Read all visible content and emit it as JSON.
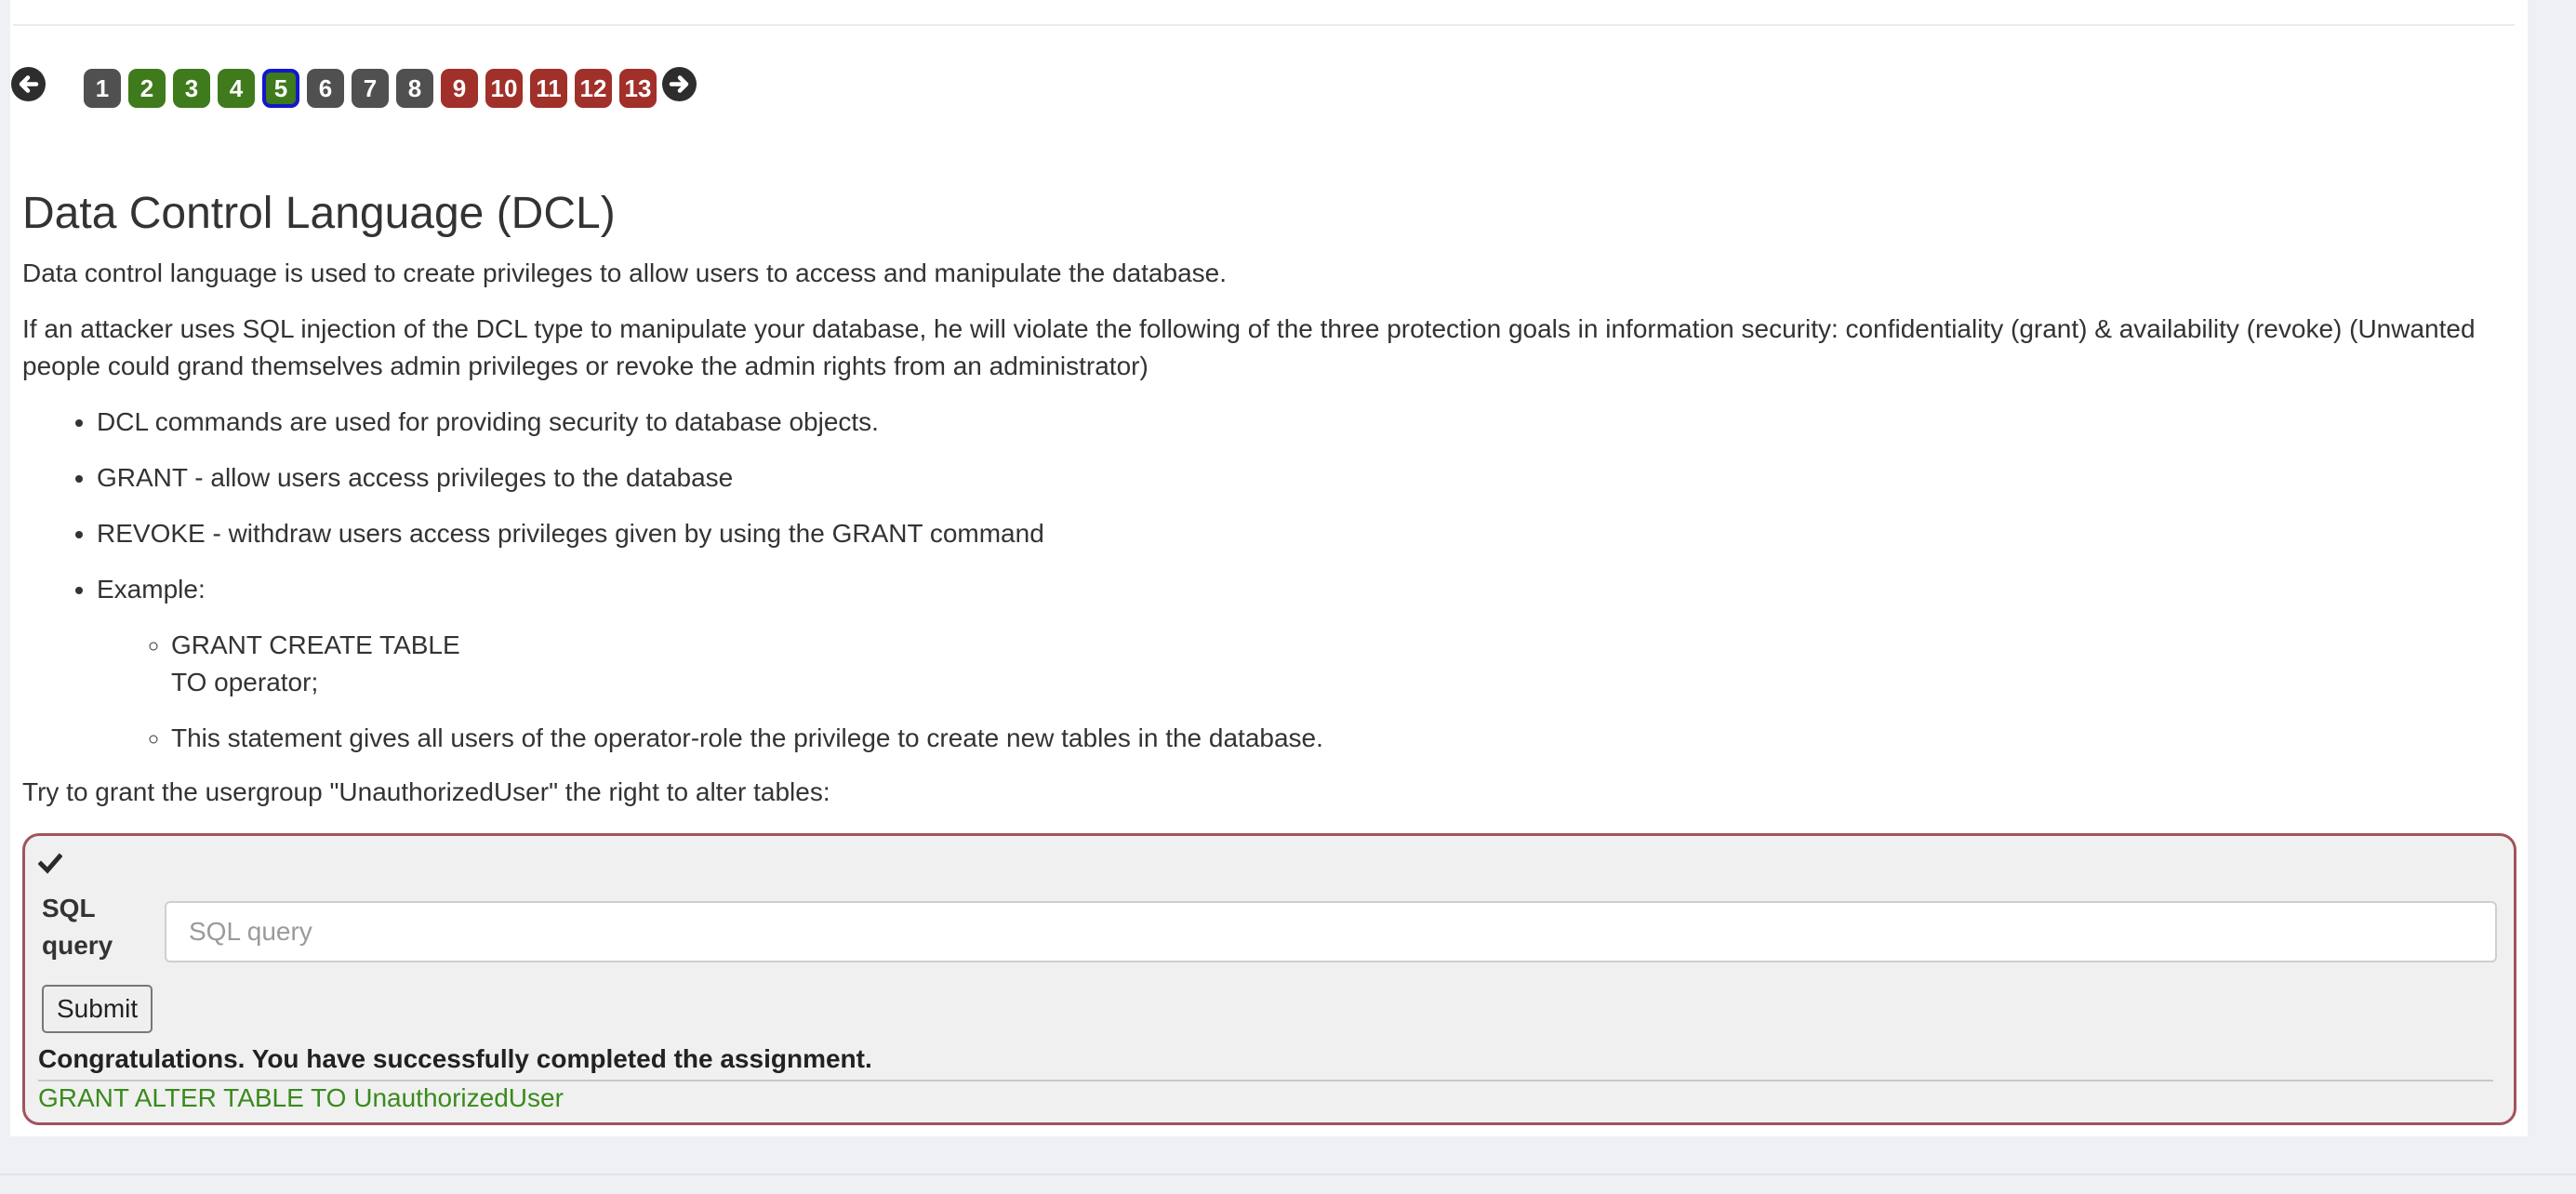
{
  "pagination": {
    "prev_icon": "arrow-left-circle-icon",
    "next_icon": "arrow-right-circle-icon",
    "pages": [
      {
        "label": "1",
        "status": "unvisited"
      },
      {
        "label": "2",
        "status": "solved"
      },
      {
        "label": "3",
        "status": "solved"
      },
      {
        "label": "4",
        "status": "solved"
      },
      {
        "label": "5",
        "status": "current"
      },
      {
        "label": "6",
        "status": "unvisited"
      },
      {
        "label": "7",
        "status": "unvisited"
      },
      {
        "label": "8",
        "status": "unvisited"
      },
      {
        "label": "9",
        "status": "unsolved"
      },
      {
        "label": "10",
        "status": "unsolved"
      },
      {
        "label": "11",
        "status": "unsolved"
      },
      {
        "label": "12",
        "status": "unsolved"
      },
      {
        "label": "13",
        "status": "unsolved"
      }
    ],
    "colors": {
      "unvisited": "#505050",
      "solved": "#3f7a1c",
      "unsolved": "#a03029",
      "current_border": "#1418c8"
    }
  },
  "lesson": {
    "title": "Data Control Language (DCL)",
    "intro": "Data control language is used to create privileges to allow users to access and manipulate the database.",
    "attack_note": "If an attacker uses SQL injection of the DCL type to manipulate your database, he will violate the following of the three protection goals in information security: confidentiality (grant) & availability (revoke) (Unwanted people could grand themselves admin privileges or revoke the admin rights from an administrator)",
    "bullets": [
      "DCL commands are used for providing security to database objects.",
      "GRANT - allow users access privileges to the database",
      "REVOKE - withdraw users access privileges given by using the GRANT command",
      "Example:"
    ],
    "example": {
      "code_line_1": "GRANT CREATE TABLE",
      "code_line_2": "TO operator;",
      "explanation": "This statement gives all users of the operator-role the privilege to create new tables in the database."
    },
    "task_prompt": "Try to grant the usergroup \"UnauthorizedUser\" the right to alter tables:"
  },
  "assignment": {
    "status_icon": "checkmark-icon",
    "sql_label": "SQL query",
    "sql_placeholder": "SQL query",
    "sql_value": "",
    "submit_label": "Submit",
    "feedback": "Congratulations. You have successfully completed the assignment.",
    "output": "GRANT ALTER TABLE TO UnauthorizedUser",
    "border_color": "#a0555a",
    "output_color": "#3a8a1c"
  }
}
